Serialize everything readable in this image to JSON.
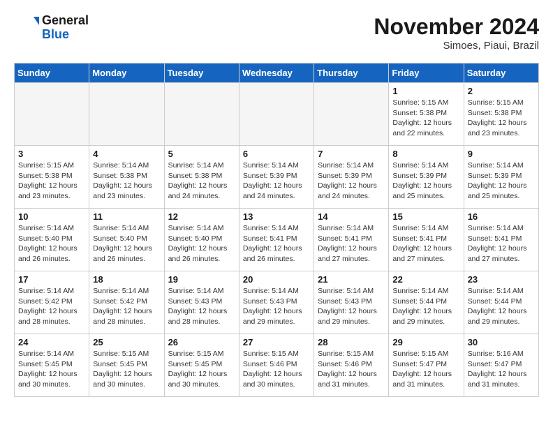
{
  "logo": {
    "text_general": "General",
    "text_blue": "Blue"
  },
  "header": {
    "month": "November 2024",
    "location": "Simoes, Piaui, Brazil"
  },
  "weekdays": [
    "Sunday",
    "Monday",
    "Tuesday",
    "Wednesday",
    "Thursday",
    "Friday",
    "Saturday"
  ],
  "weeks": [
    [
      {
        "day": "",
        "info": ""
      },
      {
        "day": "",
        "info": ""
      },
      {
        "day": "",
        "info": ""
      },
      {
        "day": "",
        "info": ""
      },
      {
        "day": "",
        "info": ""
      },
      {
        "day": "1",
        "info": "Sunrise: 5:15 AM\nSunset: 5:38 PM\nDaylight: 12 hours\nand 22 minutes."
      },
      {
        "day": "2",
        "info": "Sunrise: 5:15 AM\nSunset: 5:38 PM\nDaylight: 12 hours\nand 23 minutes."
      }
    ],
    [
      {
        "day": "3",
        "info": "Sunrise: 5:15 AM\nSunset: 5:38 PM\nDaylight: 12 hours\nand 23 minutes."
      },
      {
        "day": "4",
        "info": "Sunrise: 5:14 AM\nSunset: 5:38 PM\nDaylight: 12 hours\nand 23 minutes."
      },
      {
        "day": "5",
        "info": "Sunrise: 5:14 AM\nSunset: 5:38 PM\nDaylight: 12 hours\nand 24 minutes."
      },
      {
        "day": "6",
        "info": "Sunrise: 5:14 AM\nSunset: 5:39 PM\nDaylight: 12 hours\nand 24 minutes."
      },
      {
        "day": "7",
        "info": "Sunrise: 5:14 AM\nSunset: 5:39 PM\nDaylight: 12 hours\nand 24 minutes."
      },
      {
        "day": "8",
        "info": "Sunrise: 5:14 AM\nSunset: 5:39 PM\nDaylight: 12 hours\nand 25 minutes."
      },
      {
        "day": "9",
        "info": "Sunrise: 5:14 AM\nSunset: 5:39 PM\nDaylight: 12 hours\nand 25 minutes."
      }
    ],
    [
      {
        "day": "10",
        "info": "Sunrise: 5:14 AM\nSunset: 5:40 PM\nDaylight: 12 hours\nand 26 minutes."
      },
      {
        "day": "11",
        "info": "Sunrise: 5:14 AM\nSunset: 5:40 PM\nDaylight: 12 hours\nand 26 minutes."
      },
      {
        "day": "12",
        "info": "Sunrise: 5:14 AM\nSunset: 5:40 PM\nDaylight: 12 hours\nand 26 minutes."
      },
      {
        "day": "13",
        "info": "Sunrise: 5:14 AM\nSunset: 5:41 PM\nDaylight: 12 hours\nand 26 minutes."
      },
      {
        "day": "14",
        "info": "Sunrise: 5:14 AM\nSunset: 5:41 PM\nDaylight: 12 hours\nand 27 minutes."
      },
      {
        "day": "15",
        "info": "Sunrise: 5:14 AM\nSunset: 5:41 PM\nDaylight: 12 hours\nand 27 minutes."
      },
      {
        "day": "16",
        "info": "Sunrise: 5:14 AM\nSunset: 5:41 PM\nDaylight: 12 hours\nand 27 minutes."
      }
    ],
    [
      {
        "day": "17",
        "info": "Sunrise: 5:14 AM\nSunset: 5:42 PM\nDaylight: 12 hours\nand 28 minutes."
      },
      {
        "day": "18",
        "info": "Sunrise: 5:14 AM\nSunset: 5:42 PM\nDaylight: 12 hours\nand 28 minutes."
      },
      {
        "day": "19",
        "info": "Sunrise: 5:14 AM\nSunset: 5:43 PM\nDaylight: 12 hours\nand 28 minutes."
      },
      {
        "day": "20",
        "info": "Sunrise: 5:14 AM\nSunset: 5:43 PM\nDaylight: 12 hours\nand 29 minutes."
      },
      {
        "day": "21",
        "info": "Sunrise: 5:14 AM\nSunset: 5:43 PM\nDaylight: 12 hours\nand 29 minutes."
      },
      {
        "day": "22",
        "info": "Sunrise: 5:14 AM\nSunset: 5:44 PM\nDaylight: 12 hours\nand 29 minutes."
      },
      {
        "day": "23",
        "info": "Sunrise: 5:14 AM\nSunset: 5:44 PM\nDaylight: 12 hours\nand 29 minutes."
      }
    ],
    [
      {
        "day": "24",
        "info": "Sunrise: 5:14 AM\nSunset: 5:45 PM\nDaylight: 12 hours\nand 30 minutes."
      },
      {
        "day": "25",
        "info": "Sunrise: 5:15 AM\nSunset: 5:45 PM\nDaylight: 12 hours\nand 30 minutes."
      },
      {
        "day": "26",
        "info": "Sunrise: 5:15 AM\nSunset: 5:45 PM\nDaylight: 12 hours\nand 30 minutes."
      },
      {
        "day": "27",
        "info": "Sunrise: 5:15 AM\nSunset: 5:46 PM\nDaylight: 12 hours\nand 30 minutes."
      },
      {
        "day": "28",
        "info": "Sunrise: 5:15 AM\nSunset: 5:46 PM\nDaylight: 12 hours\nand 31 minutes."
      },
      {
        "day": "29",
        "info": "Sunrise: 5:15 AM\nSunset: 5:47 PM\nDaylight: 12 hours\nand 31 minutes."
      },
      {
        "day": "30",
        "info": "Sunrise: 5:16 AM\nSunset: 5:47 PM\nDaylight: 12 hours\nand 31 minutes."
      }
    ]
  ]
}
